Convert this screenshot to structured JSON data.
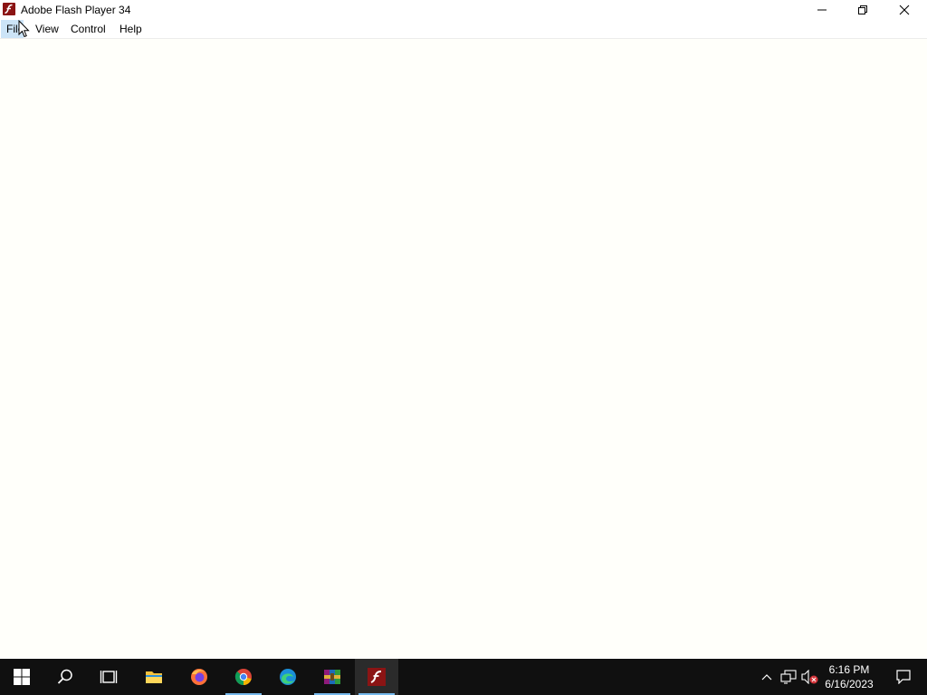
{
  "window": {
    "title": "Adobe Flash Player 34",
    "menu": {
      "file": "File",
      "view": "View",
      "control": "Control",
      "help": "Help"
    }
  },
  "taskbar": {
    "apps": [
      {
        "name": "start",
        "icon": "windows-logo-icon"
      },
      {
        "name": "search",
        "icon": "search-icon"
      },
      {
        "name": "task-view",
        "icon": "task-view-icon"
      },
      {
        "name": "file-explorer",
        "icon": "folder-icon"
      },
      {
        "name": "firefox",
        "icon": "firefox-icon"
      },
      {
        "name": "chrome",
        "icon": "chrome-icon"
      },
      {
        "name": "edge",
        "icon": "edge-icon"
      },
      {
        "name": "winrar",
        "icon": "winrar-icon"
      },
      {
        "name": "flash-player",
        "icon": "flash-icon",
        "active": true
      }
    ],
    "clock": {
      "time": "6:16 PM",
      "date": "6/16/2023"
    }
  },
  "colors": {
    "taskbar_bg": "#101010",
    "flash_red": "#8b1414",
    "menu_highlight": "#cce4f7",
    "active_indicator": "#76b9ed"
  }
}
